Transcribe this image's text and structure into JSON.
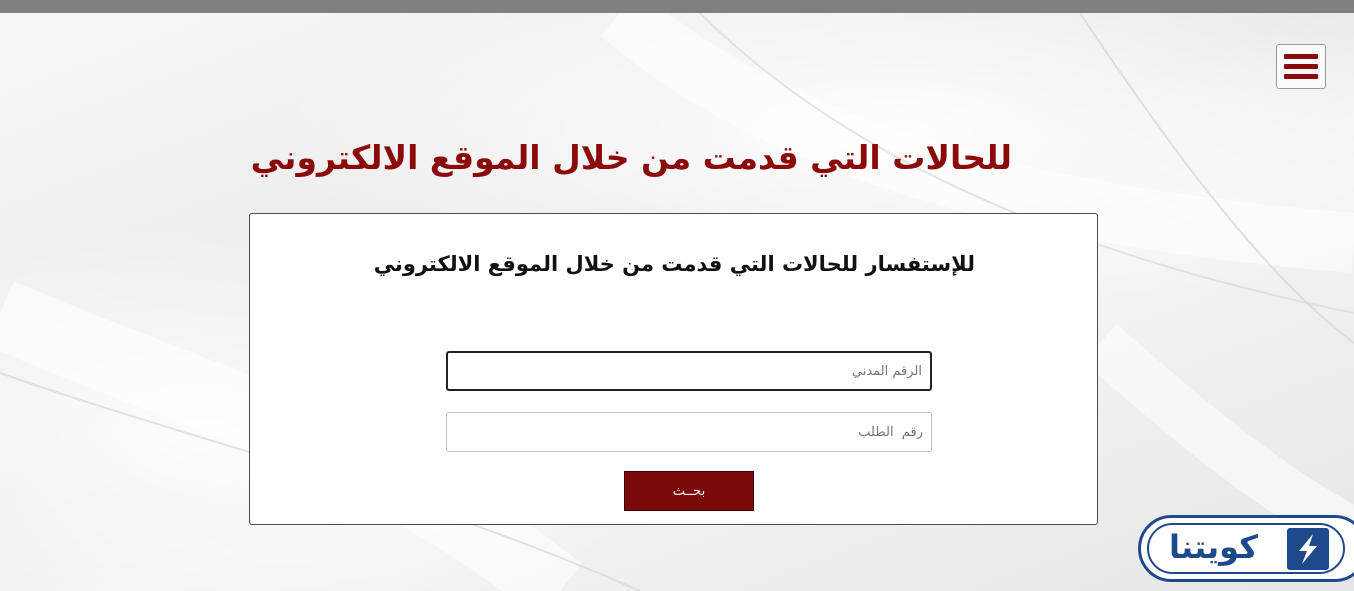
{
  "header": {
    "menu_icon": "hamburger-menu-icon",
    "accent_color": "#8b0a0a"
  },
  "page": {
    "title": "للحالات التي قدمت من خلال الموقع الالكتروني"
  },
  "form": {
    "title": "للإستفسار للحالات التي قدمت من خلال الموقع الالكتروني",
    "civil_id_placeholder": "الرقم المدني",
    "request_number_placeholder": "رقم  الطلب",
    "search_label": "بحــث",
    "button_color": "#7d0a0a"
  },
  "brand": {
    "name": "كويتنا",
    "logo_icon": "brand-logo-icon",
    "color": "#1e4a8c"
  }
}
